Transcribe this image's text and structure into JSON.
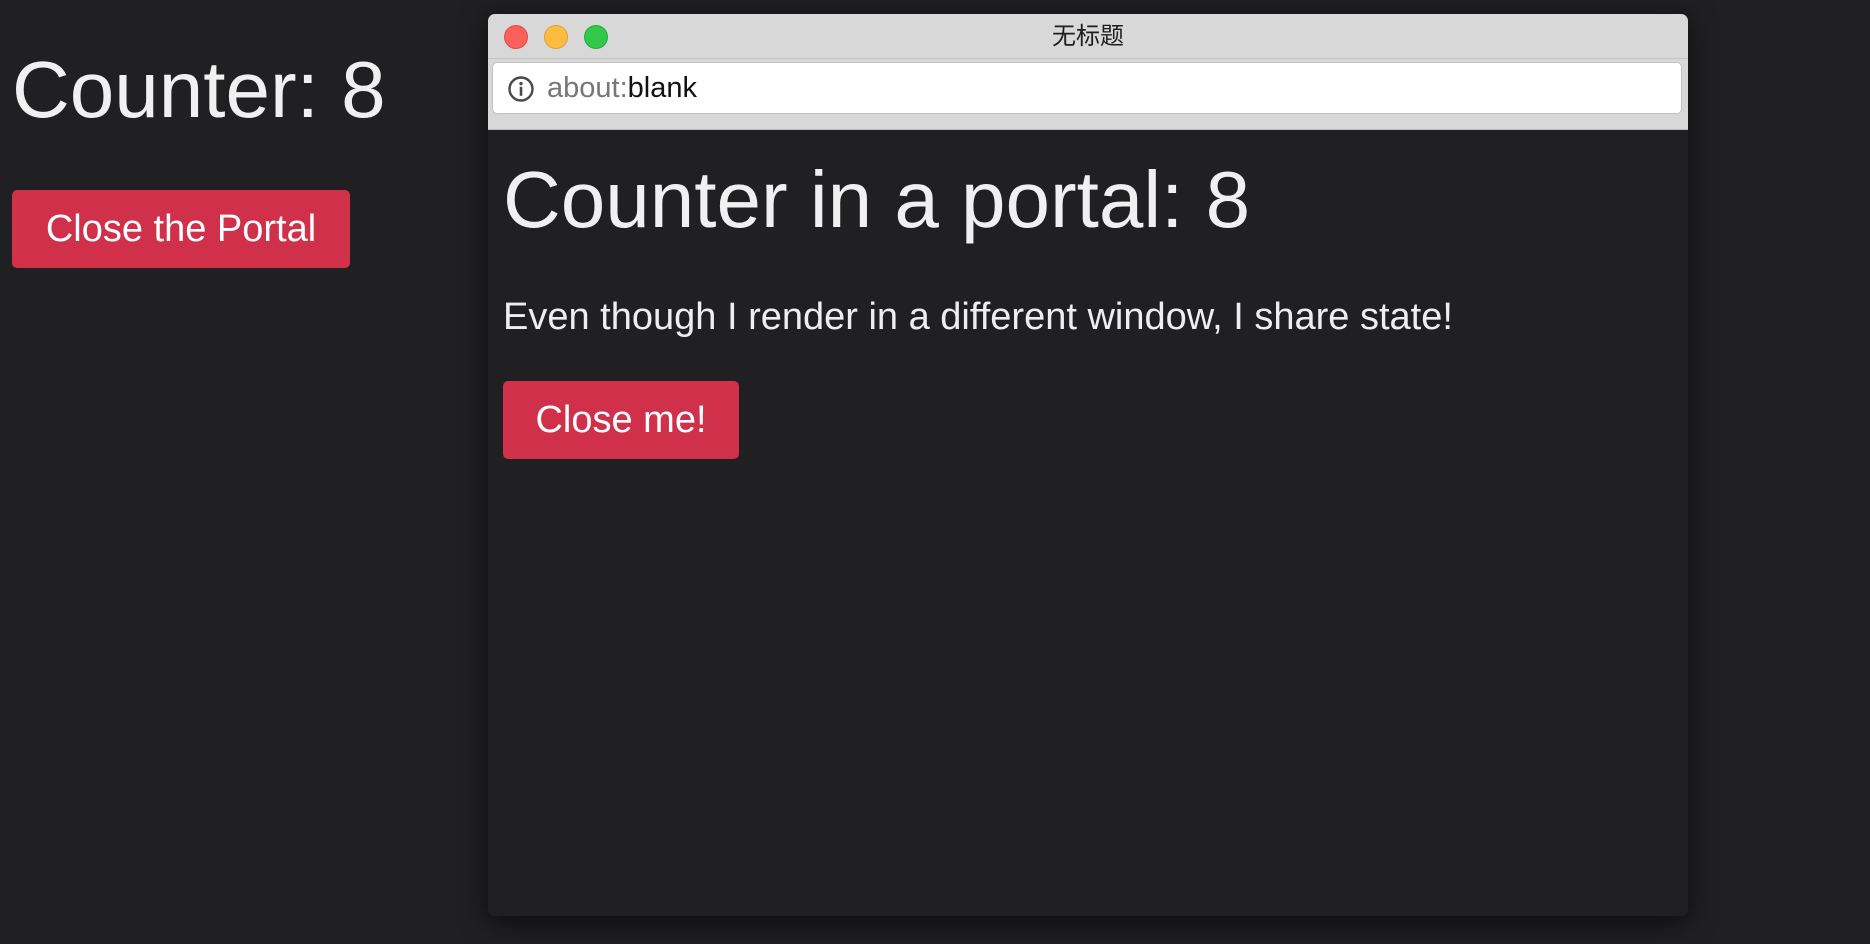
{
  "main": {
    "heading": "Counter: 8",
    "close_portal_label": "Close the Portal"
  },
  "popup": {
    "window_title": "无标题",
    "url_scheme": "about:",
    "url_path": "blank",
    "heading": "Counter in a portal: 8",
    "text": "Even though I render in a different window, I share state!",
    "close_me_label": "Close me!"
  },
  "colors": {
    "background": "#202022",
    "danger_button": "#d0304a",
    "text": "#f0f0f0"
  },
  "icons": {
    "traffic_close": "close-window-icon",
    "traffic_min": "minimize-window-icon",
    "traffic_max": "maximize-window-icon",
    "url_info": "info-icon"
  }
}
